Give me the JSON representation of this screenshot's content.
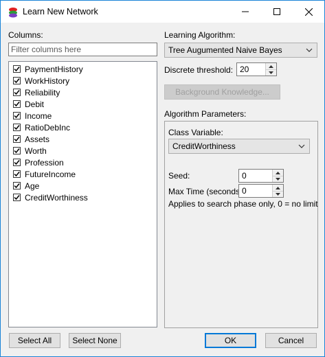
{
  "window": {
    "title": "Learn New Network"
  },
  "columns": {
    "label": "Columns:",
    "filter_placeholder": "Filter columns here",
    "items": [
      {
        "label": "PaymentHistory",
        "checked": true
      },
      {
        "label": "WorkHistory",
        "checked": true
      },
      {
        "label": "Reliability",
        "checked": true
      },
      {
        "label": "Debit",
        "checked": true
      },
      {
        "label": "Income",
        "checked": true
      },
      {
        "label": "RatioDebInc",
        "checked": true
      },
      {
        "label": "Assets",
        "checked": true
      },
      {
        "label": "Worth",
        "checked": true
      },
      {
        "label": "Profession",
        "checked": true
      },
      {
        "label": "FutureIncome",
        "checked": true
      },
      {
        "label": "Age",
        "checked": true
      },
      {
        "label": "CreditWorthiness",
        "checked": true
      }
    ]
  },
  "algorithm": {
    "label": "Learning Algorithm:",
    "selected": "Tree Augumented Naive Bayes",
    "discrete_label": "Discrete threshold:",
    "discrete_value": "20",
    "background_button": "Background Knowledge..."
  },
  "params": {
    "label": "Algorithm Parameters:",
    "class_label": "Class Variable:",
    "class_selected": "CreditWorthiness",
    "seed_label": "Seed:",
    "seed_value": "0",
    "maxtime_label": "Max Time (seconds):",
    "maxtime_value": "0",
    "note": "Applies to search phase only, 0 = no limit"
  },
  "buttons": {
    "select_all": "Select All",
    "select_none": "Select None",
    "ok": "OK",
    "cancel": "Cancel"
  }
}
